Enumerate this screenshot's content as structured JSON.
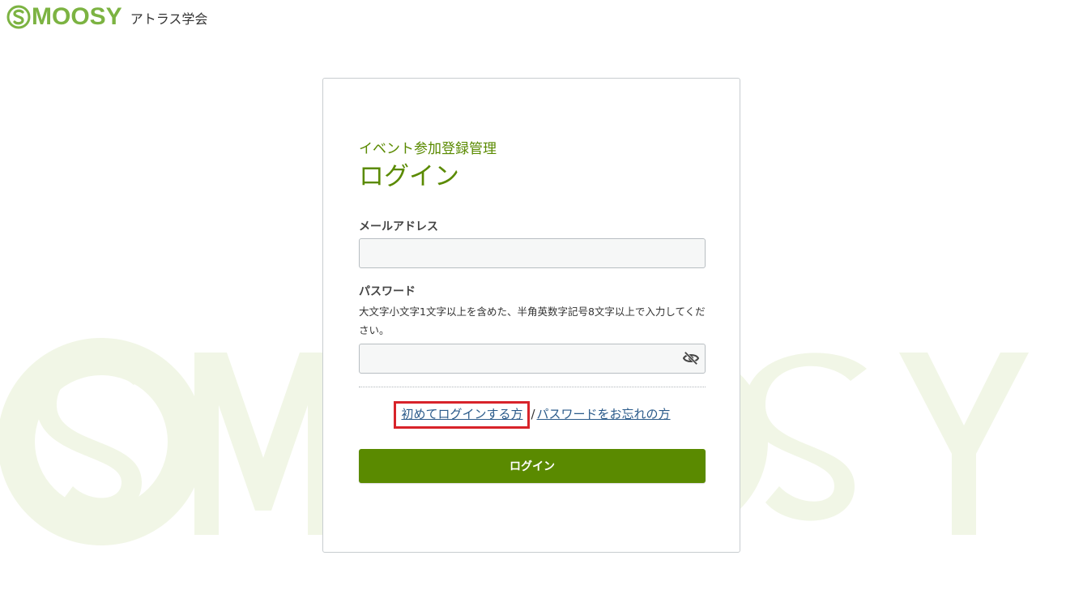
{
  "header": {
    "logo_text": "MOOSY",
    "logo_prefix": "S",
    "org_name": "アトラス学会"
  },
  "watermark": {
    "text": "SMOOSY"
  },
  "login_card": {
    "subtitle": "イベント参加登録管理",
    "title": "ログイン",
    "email": {
      "label": "メールアドレス",
      "value": "",
      "placeholder": ""
    },
    "password": {
      "label": "パスワード",
      "hint": "大文字小文字1文字以上を含めた、半角英数字記号8文字以上で入力してください。",
      "value": "",
      "placeholder": "",
      "toggle_icon": "eye-slash-icon"
    },
    "links": {
      "first_login": "初めてログインする方",
      "separator": "/",
      "forgot_password": "パスワードをお忘れの方"
    },
    "submit_label": "ログイン"
  },
  "colors": {
    "brand_green": "#5a8a00",
    "logo_green": "#7cb342",
    "link_blue": "#2a5a8a",
    "highlight_red": "#d8232a",
    "watermark": "#f1f6e6"
  }
}
